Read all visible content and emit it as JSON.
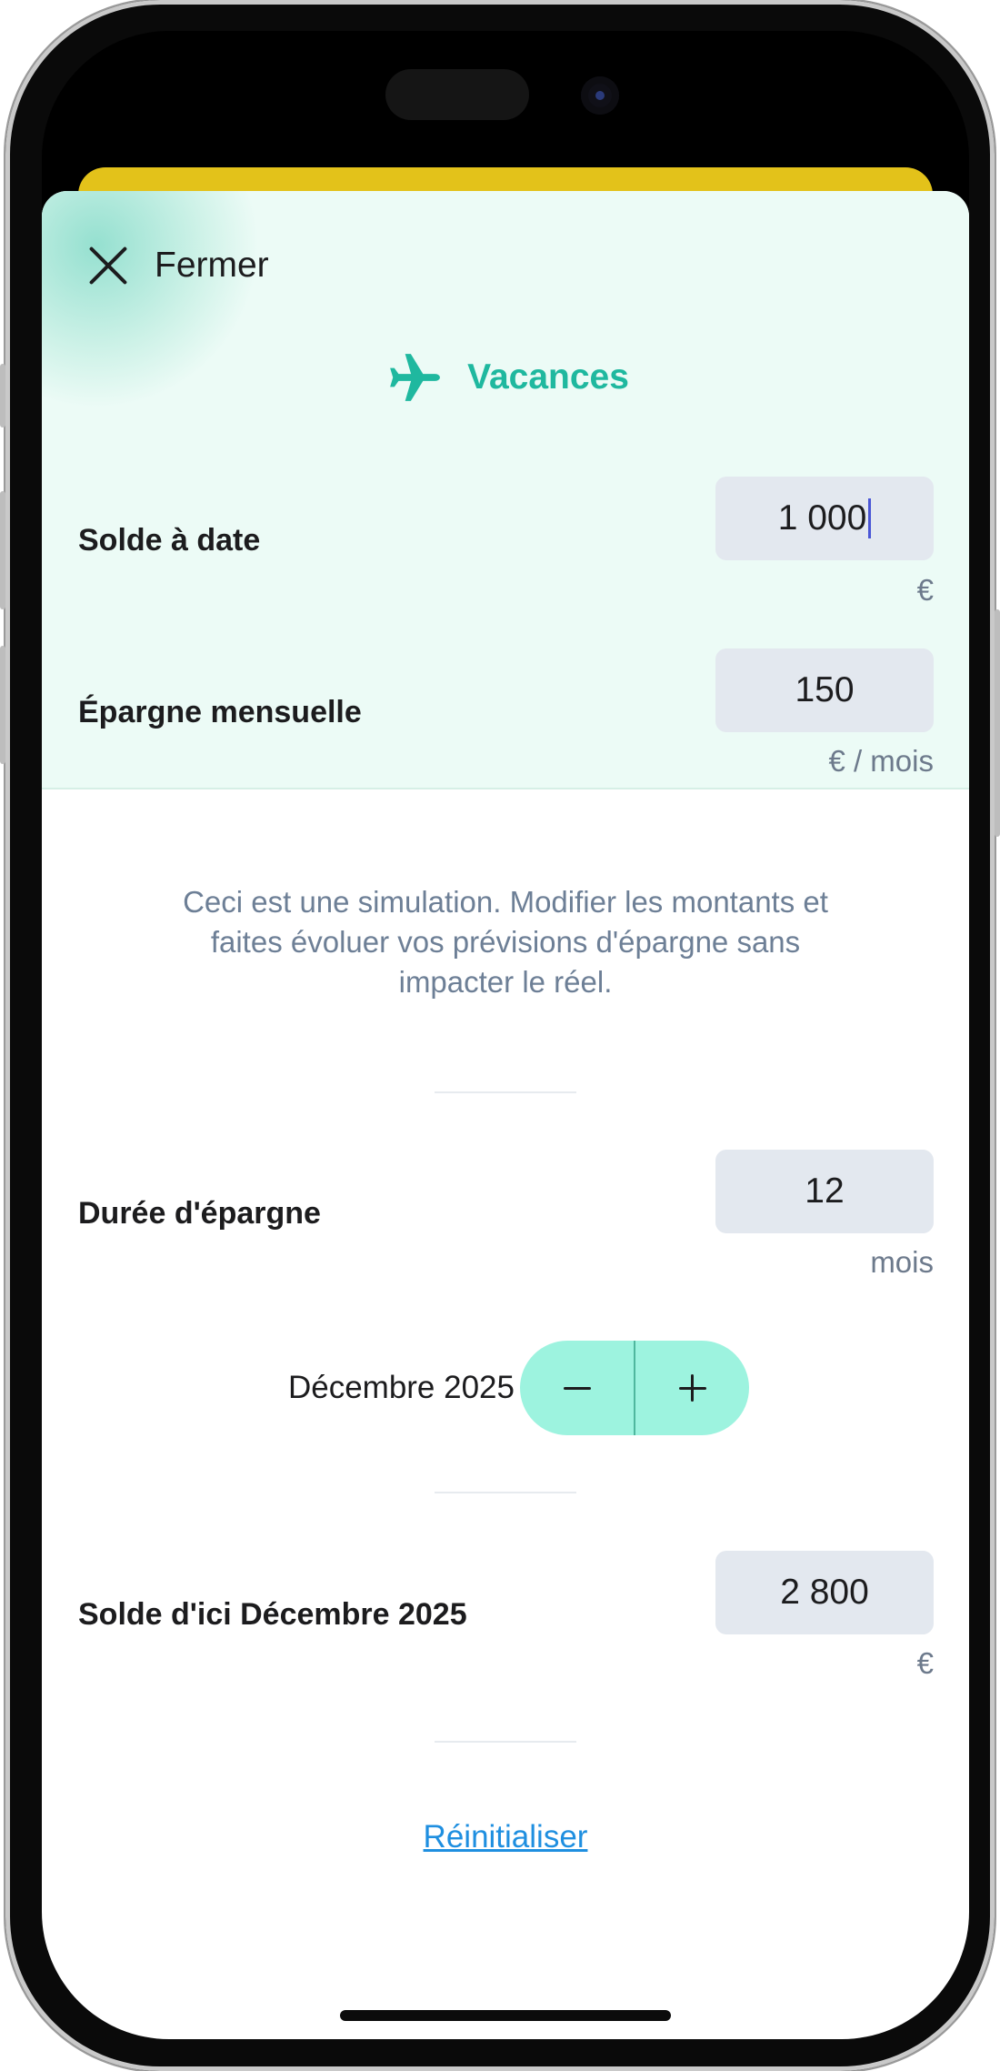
{
  "header": {
    "close_label": "Fermer",
    "title": "Vacances",
    "title_icon": "airplane-icon",
    "accent_color": "#1fb89f"
  },
  "balance": {
    "label": "Solde à date",
    "value": "1 000",
    "unit": "€"
  },
  "monthly_savings": {
    "label": "Épargne mensuelle",
    "value": "150",
    "unit": "€ / mois"
  },
  "info": {
    "text": "Ceci est une simulation. Modifier les montants et faites évoluer vos prévisions d'épargne sans impacter le réel."
  },
  "duration": {
    "label": "Durée d'épargne",
    "value": "12",
    "unit": "mois",
    "end_date": "Décembre 2025",
    "minus_icon": "minus-icon",
    "plus_icon": "plus-icon"
  },
  "projected": {
    "label": "Solde d'ici Décembre 2025",
    "value": "2 800",
    "unit": "€"
  },
  "reset": {
    "label": "Réinitialiser",
    "color": "#1f8fe0"
  }
}
